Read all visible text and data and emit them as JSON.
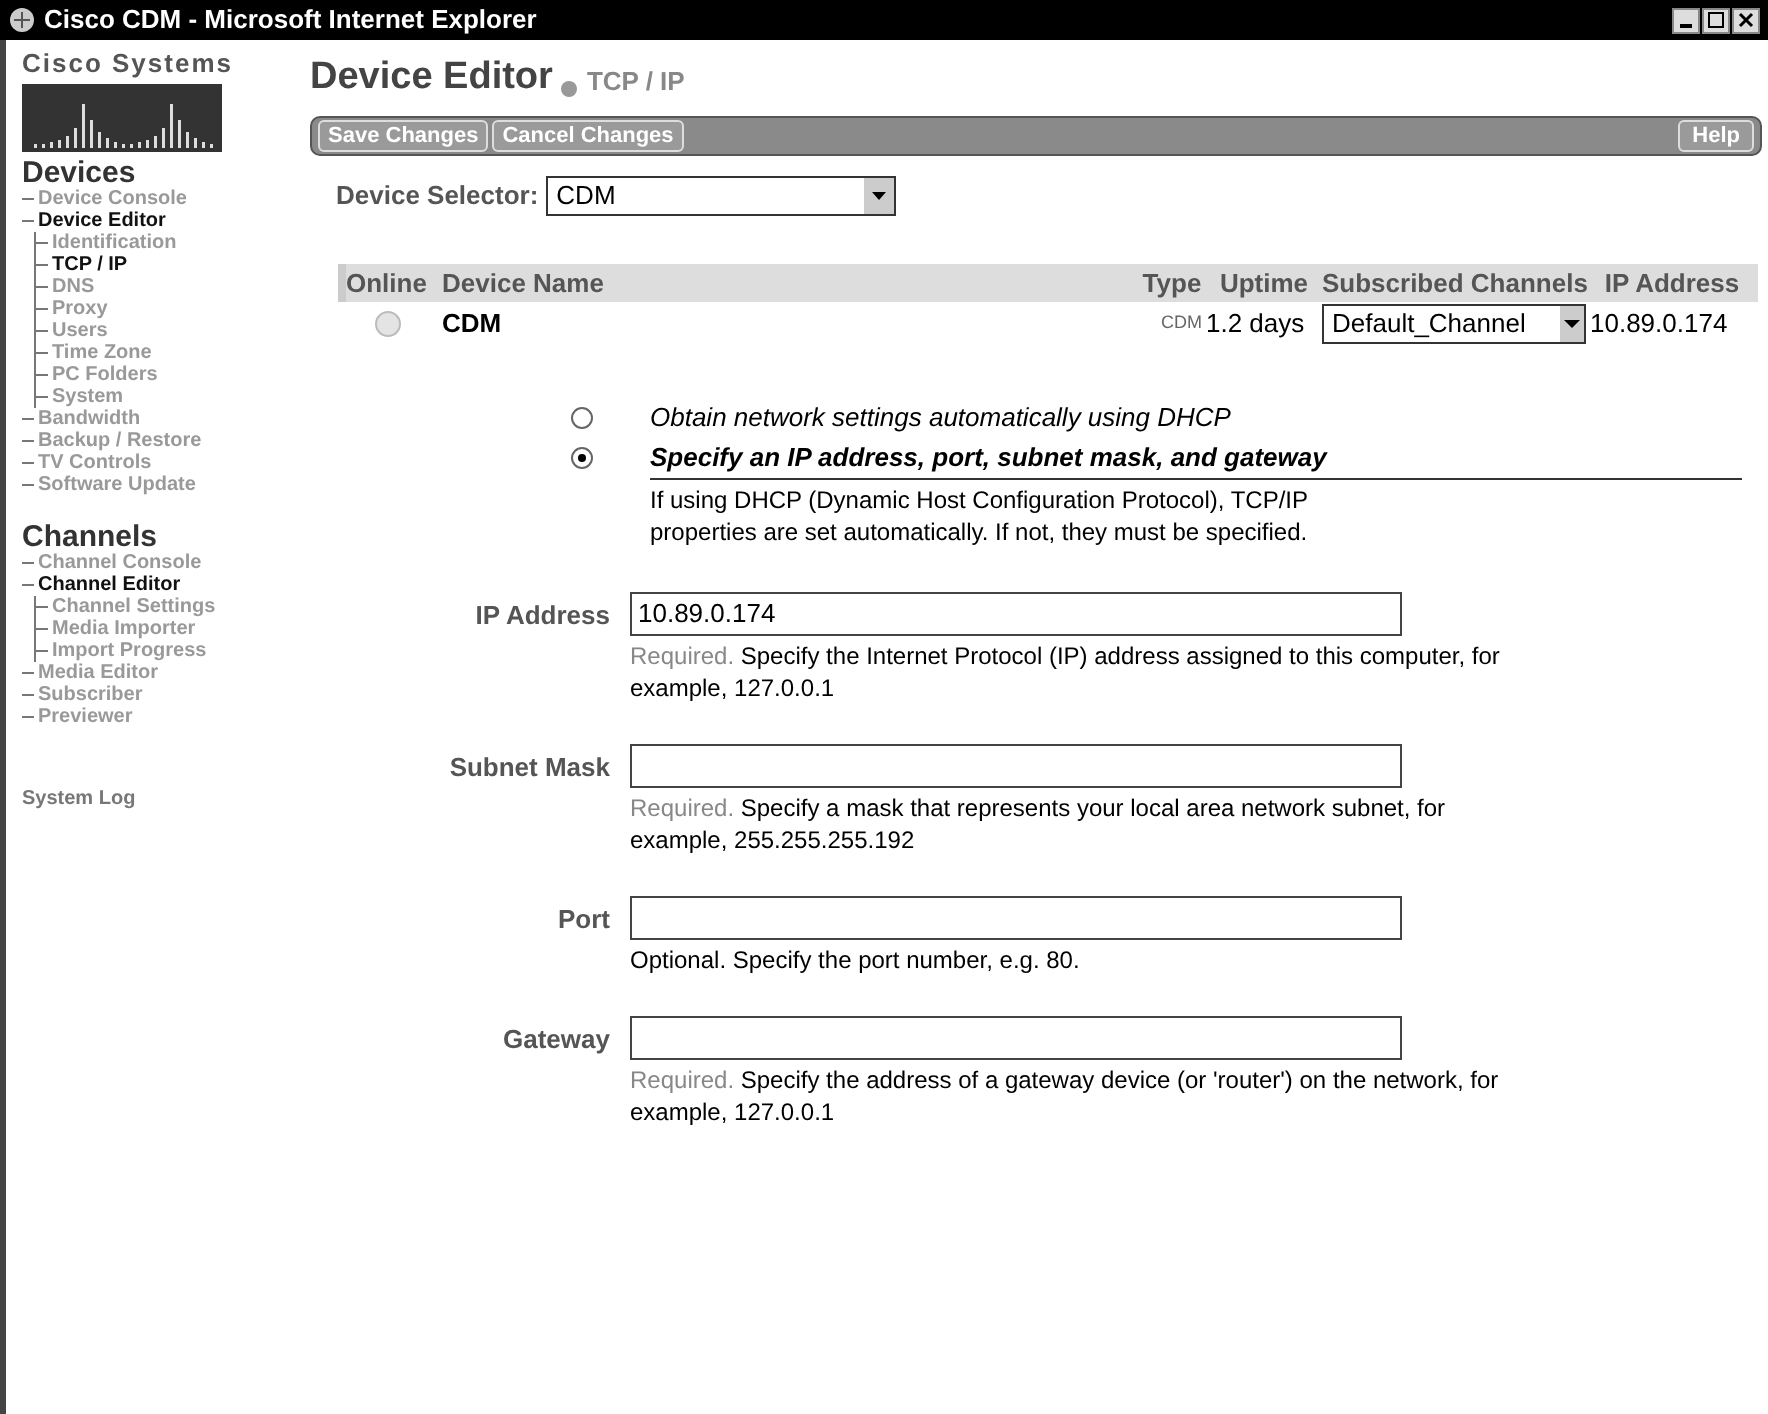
{
  "window": {
    "title": "Cisco CDM - Microsoft Internet Explorer"
  },
  "sidebar": {
    "logo": "Cisco Systems",
    "sections": [
      {
        "title": "Devices",
        "items": [
          {
            "label": "Device Console",
            "selected": false
          },
          {
            "label": "Device Editor",
            "selected": true,
            "children": [
              {
                "label": "Identification",
                "selected": false
              },
              {
                "label": "TCP / IP",
                "selected": true
              },
              {
                "label": "DNS",
                "selected": false
              },
              {
                "label": "Proxy",
                "selected": false
              },
              {
                "label": "Users",
                "selected": false
              },
              {
                "label": "Time Zone",
                "selected": false
              },
              {
                "label": "PC Folders",
                "selected": false
              },
              {
                "label": "System",
                "selected": false
              }
            ]
          },
          {
            "label": "Bandwidth",
            "selected": false
          },
          {
            "label": "Backup / Restore",
            "selected": false
          },
          {
            "label": "TV Controls",
            "selected": false
          },
          {
            "label": "Software Update",
            "selected": false
          }
        ]
      },
      {
        "title": "Channels",
        "items": [
          {
            "label": "Channel Console",
            "selected": false
          },
          {
            "label": "Channel Editor",
            "selected": true,
            "children": [
              {
                "label": "Channel Settings",
                "selected": false
              },
              {
                "label": "Media Importer",
                "selected": false
              },
              {
                "label": "Import Progress",
                "selected": false
              }
            ]
          },
          {
            "label": "Media Editor",
            "selected": false
          },
          {
            "label": "Subscriber",
            "selected": false
          },
          {
            "label": "Previewer",
            "selected": false
          }
        ]
      }
    ],
    "footer_link": "System Log"
  },
  "header": {
    "title": "Device Editor",
    "subtitle": "TCP / IP"
  },
  "toolbar": {
    "buttons": [
      "Save Changes",
      "Cancel Changes"
    ],
    "help": "Help"
  },
  "device_selector": {
    "label": "Device Selector:",
    "value": "CDM"
  },
  "table": {
    "columns": [
      "Online",
      "Device Name",
      "Type",
      "Uptime",
      "Subscribed Channels",
      "IP Address"
    ],
    "rows": [
      {
        "online": false,
        "name": "CDM",
        "type": "CDM",
        "uptime": "1.2 days",
        "channel": "Default_Channel",
        "ip": "10.89.0.174"
      }
    ]
  },
  "options": [
    {
      "label": "Obtain network settings automatically using DHCP",
      "selected": false
    },
    {
      "label": "Specify an IP address, port, subnet mask, and gateway",
      "selected": true
    }
  ],
  "options_help": "If using DHCP (Dynamic Host Configuration Protocol), TCP/IP properties are set automatically. If not, they must be specified.",
  "fields": [
    {
      "label": "IP Address",
      "value": "10.89.0.174",
      "note": "Required.",
      "help": "Specify the Internet Protocol (IP) address assigned to this computer, for example, 127.0.0.1"
    },
    {
      "label": "Subnet Mask",
      "note": "Required.",
      "help": "Specify a mask that represents your local area network subnet, for example, 255.255.255.192"
    },
    {
      "label": "Port",
      "note": "Optional.",
      "help": "Specify the port number, e.g. 80."
    },
    {
      "label": "Gateway",
      "note": "Required.",
      "help": "Specify the address of a gateway device (or 'router') on the network, for example, 127.0.0.1"
    }
  ]
}
